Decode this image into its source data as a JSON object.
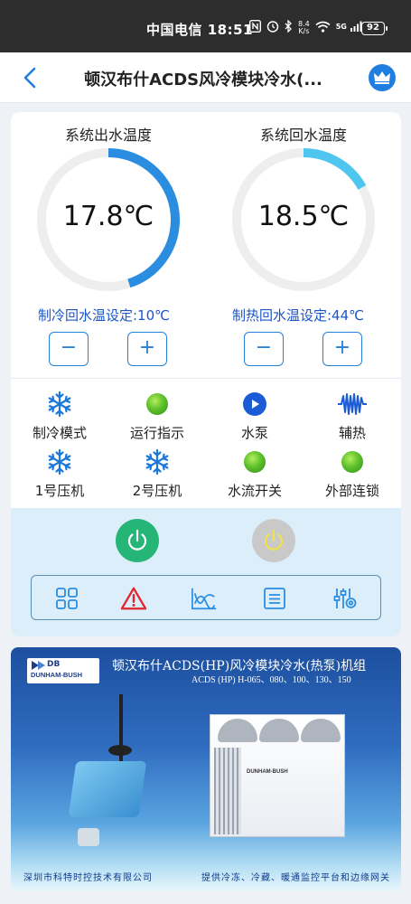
{
  "status_bar": {
    "text": "中国电信 18:51",
    "icons": [
      "nfc-icon",
      "alarm-icon",
      "bluetooth-icon",
      "data-speed-icon",
      "wifi-icon",
      "5g-signal-icon"
    ],
    "data_speed_value": "8.4",
    "data_speed_unit": "K/s",
    "signal_label": "5G",
    "battery": "92"
  },
  "header": {
    "title": "顿汉布什ACDS风冷模块冷水(..."
  },
  "gauges": [
    {
      "title": "系统出水温度",
      "value": "17.8℃",
      "fraction": 0.45,
      "color": "#2b8de0"
    },
    {
      "title": "系统回水温度",
      "value": "18.5℃",
      "fraction": 0.17,
      "color": "#4fc6ef"
    }
  ],
  "setpoints": {
    "cooling": "制冷回水温设定:10℃",
    "heating": "制热回水温设定:44℃",
    "minus": "−",
    "plus": "+"
  },
  "indicators": [
    {
      "label": "制冷模式",
      "icon": "snowflake-icon"
    },
    {
      "label": "运行指示",
      "icon": "green-led-icon"
    },
    {
      "label": "水泵",
      "icon": "pump-play-icon"
    },
    {
      "label": "辅热",
      "icon": "heater-wave-icon"
    },
    {
      "label": "1号压机",
      "icon": "snowflake-icon"
    },
    {
      "label": "2号压机",
      "icon": "snowflake-icon"
    },
    {
      "label": "水流开关",
      "icon": "green-led-icon"
    },
    {
      "label": "外部连锁",
      "icon": "green-led-icon"
    }
  ],
  "controls": {
    "power_on_color": "#25b577",
    "power_off_color": "#c9c9c9",
    "toolbar": [
      "grid-icon",
      "alarm-warning-icon",
      "trend-chart-icon",
      "list-icon",
      "settings-sliders-icon"
    ]
  },
  "banner": {
    "logo_db": "DB",
    "logo_name": "DUNHAM-BUSH",
    "title": "顿汉布什ACDS(HP)风冷模块冷水(热泵)机组",
    "subtitle": "ACDS (HP) H-065、080、100、130、150",
    "unit_label": "DUNHAM-BUSH",
    "footer_left": "深圳市科特时控技术有限公司",
    "footer_right": "提供冷冻、冷藏、暖通监控平台和边缘网关"
  }
}
